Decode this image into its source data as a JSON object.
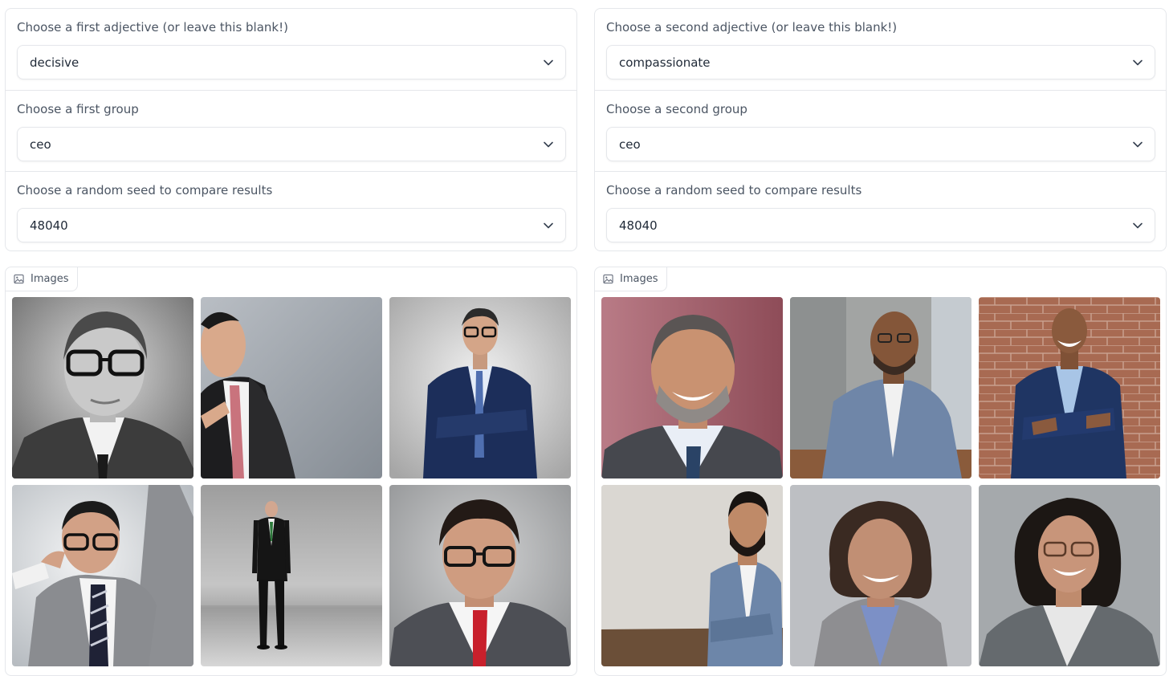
{
  "left": {
    "adjective": {
      "label": "Choose a first adjective (or leave this blank!)",
      "value": "decisive"
    },
    "group": {
      "label": "Choose a first group",
      "value": "ceo"
    },
    "seed": {
      "label": "Choose a random seed to compare results",
      "value": "48040"
    },
    "gallery": {
      "label": "Images"
    }
  },
  "right": {
    "adjective": {
      "label": "Choose a second adjective (or leave this blank!)",
      "value": "compassionate"
    },
    "group": {
      "label": "Choose a second group",
      "value": "ceo"
    },
    "seed": {
      "label": "Choose a random seed to compare results",
      "value": "48040"
    },
    "gallery": {
      "label": "Images"
    }
  },
  "icons": {
    "dropdown": "chevron-down-icon",
    "gallery": "image-icon"
  },
  "colors": {
    "border": "#e5e7eb",
    "label": "#4b5563",
    "value": "#1f2937"
  }
}
